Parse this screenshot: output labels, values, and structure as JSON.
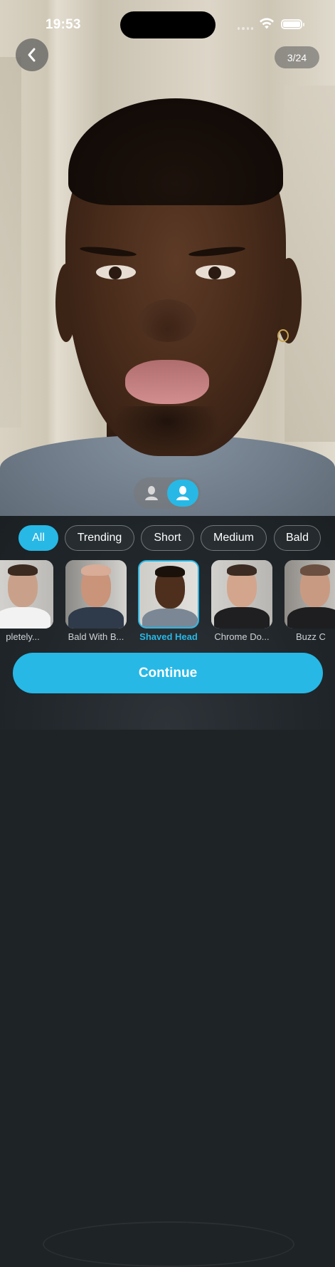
{
  "status_bar": {
    "time": "19:53"
  },
  "header": {
    "counter": "3/24"
  },
  "filters": [
    {
      "label": "All",
      "active": true
    },
    {
      "label": "Trending",
      "active": false
    },
    {
      "label": "Short",
      "active": false
    },
    {
      "label": "Medium",
      "active": false
    },
    {
      "label": "Bald",
      "active": false
    }
  ],
  "styles": [
    {
      "label": "pletely...",
      "selected": false
    },
    {
      "label": "Bald With B...",
      "selected": false
    },
    {
      "label": "Shaved Head",
      "selected": true
    },
    {
      "label": "Chrome Do...",
      "selected": false
    },
    {
      "label": "Buzz C",
      "selected": false
    }
  ],
  "actions": {
    "continue_label": "Continue"
  },
  "colors": {
    "accent": "#27b8e6",
    "sheet_bg": "#1e2326"
  },
  "icons": {
    "back": "chevron-left-icon",
    "view_a": "silhouette-icon",
    "view_b": "person-icon"
  }
}
